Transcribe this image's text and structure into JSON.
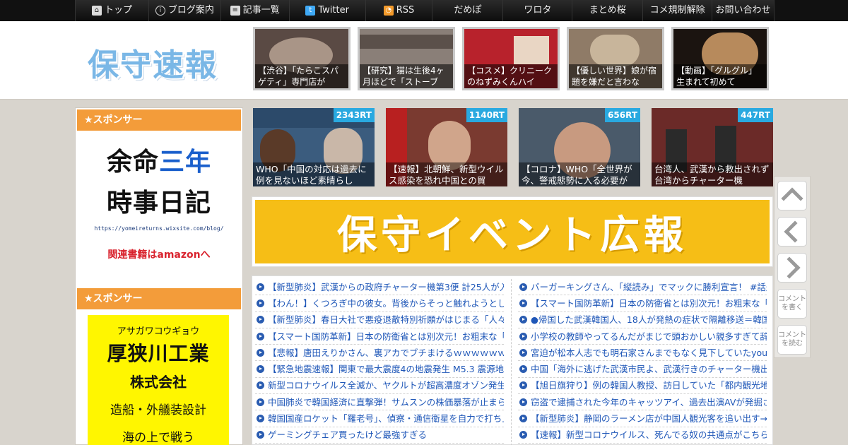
{
  "nav": {
    "items": [
      {
        "label": "トップ",
        "icon": "home-icon"
      },
      {
        "label": "ブログ案内",
        "icon": "info-icon"
      },
      {
        "label": "記事一覧",
        "icon": "list-icon"
      },
      {
        "label": "Twitter",
        "icon": "twitter-icon"
      },
      {
        "label": "RSS",
        "icon": "rss-icon"
      },
      {
        "label": "だめぽ"
      },
      {
        "label": "ワロタ"
      },
      {
        "label": "まとめ桜"
      },
      {
        "label": "コメ規制解除"
      },
      {
        "label": "お問い合わせ"
      }
    ]
  },
  "header": {
    "logo_text": "保守速報",
    "thumbs": [
      {
        "caption": "【渋谷】「たらこスパゲティ」専門店が",
        "bg": "#5a4a44"
      },
      {
        "caption": "【研究】猫は生後4ヶ月ほどで「ストーブ",
        "bg": "#8a7f78"
      },
      {
        "caption": "【コスメ】クリニークのねずみくんハイ",
        "bg": "#b8222c"
      },
      {
        "caption": "【優しい世界】娘が宿題を嫌だと言わな",
        "bg": "#8f7b67"
      },
      {
        "caption": "【動画】「グルグル」生まれて初めて",
        "bg": "#6b4e33"
      }
    ]
  },
  "sidebar": {
    "sponsor_label_1": "★スポンサー",
    "ad1": {
      "line1_a": "余命",
      "line1_b": "三年",
      "line2": "時事日記",
      "url": "https://yomeireturns.wixsite.com/blog/",
      "amazon": "関連書籍はamazonへ"
    },
    "sponsor_label_2": "★スポンサー",
    "ad2": {
      "kana": "アサガワコウギョウ",
      "name": "厚狭川工業",
      "corp": "株式会社",
      "business": "造船・外艤装設計",
      "slogan": "海の上で戦う"
    }
  },
  "rt_cards": [
    {
      "badge": "2343RT",
      "caption": "WHO「中国の対応は過去に例を見ないほど素晴らし",
      "bg": "#3b5c7e"
    },
    {
      "badge": "1140RT",
      "caption": "【速報】北朝鮮、新型ウイルス感染を恐れ中国との貿",
      "bg": "#7a3a30"
    },
    {
      "badge": "656RT",
      "caption": "【コロナ】WHO「全世界が今、警戒態勢に入る必要が",
      "bg": "#4a5a6a"
    },
    {
      "badge": "447RT",
      "caption": "台湾人、武漢から救出されず 台湾からチャーター機",
      "bg": "#6b2a28"
    }
  ],
  "event_banner": {
    "text": "保守イベント広報"
  },
  "list_left": [
    "【新型肺炎】武漢からの政府チャーター機第3便 計25人が入院",
    "【わん！】くつろぎ中の彼女。背後からそっと触れようとしたら",
    "【新型肺炎】春日大社で悪疫退散特別祈願がはじまる「人々が",
    "【スマート国防革新】日本の防衛省とは別次元！お粗末な「韓",
    "【悲報】唐田えりかさん、裏アカでブチまけるｗｗｗｗｗｗ",
    "【緊急地震速報】関東で最大震度4の地震発生 M5.3 震源地は茨城",
    "新型コロナウイルス全滅か、ヤクルトが超高濃度オゾン発生機",
    "中国肺炎で韓国経済に直撃弾！サムスンの株価暴落が止まらな",
    "韓国国産ロケット「羅老号」、偵察・通信衛星を自力で打ち上げ",
    "ゲーミングチェア買ったけど最強すぎる"
  ],
  "list_right": [
    "バーガーキングさん、「縦読み」でマックに勝利宣言！ #話題",
    "【スマート国防革新】日本の防衛省とは別次元！お粗末な「韓",
    "●帰国した武漢韓国人、18人が発熱の症状で隔離移送＝韓国の",
    "小学校の教師やってるんだがまじで頭おかしい親多すぎて辞め",
    "宮迫が松本人志でも明石家さんまでもなく見下していたyoutuber",
    "中国「海外に逃げた武漢市民よ、武漢行きのチャーター機出す",
    "【旭日旗狩り】例の韓国人教授、訪日していた「都内観光地、",
    "窃盗で逮捕された今年のキャッツアイ、過去出演AVが発掘され",
    "【新型肺炎】静岡のラーメン店が中国人観光客を追い出す→中",
    "【速報】新型コロナウイルス、死んでる奴の共通点がこちら・・"
  ],
  "float_buttons": {
    "up_icon": "chevron-up-icon",
    "left_icon": "chevron-left-icon",
    "right_icon": "chevron-right-icon",
    "write_comment": "コメントを書く",
    "read_comment": "コメントを読む"
  }
}
